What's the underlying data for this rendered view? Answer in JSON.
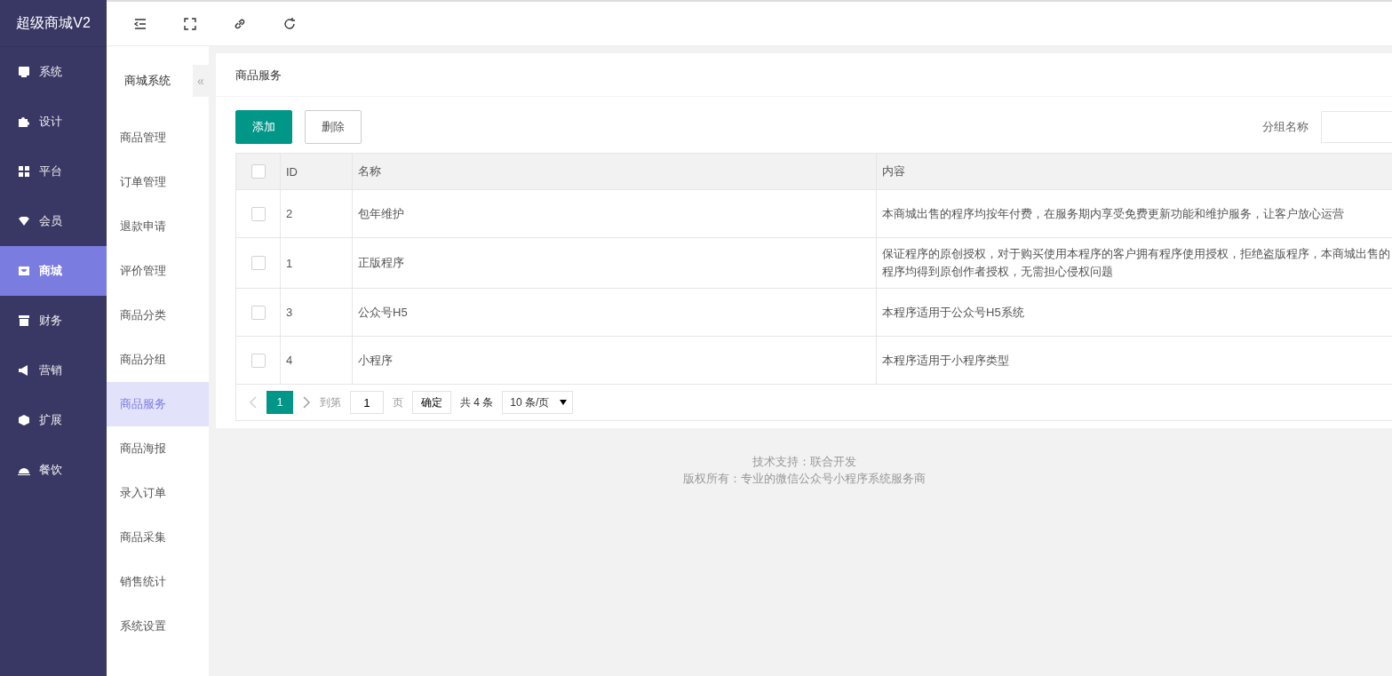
{
  "brand": "超级商城V2",
  "nav": [
    {
      "label": "系统",
      "selected": false
    },
    {
      "label": "设计",
      "selected": false
    },
    {
      "label": "平台",
      "selected": false
    },
    {
      "label": "会员",
      "selected": false
    },
    {
      "label": "商城",
      "selected": true
    },
    {
      "label": "财务",
      "selected": false
    },
    {
      "label": "营销",
      "selected": false
    },
    {
      "label": "扩展",
      "selected": false
    },
    {
      "label": "餐饮",
      "selected": false
    }
  ],
  "subnav": {
    "title": "商城系统",
    "collapse": "«",
    "items": [
      {
        "label": "商品管理",
        "selected": false
      },
      {
        "label": "订单管理",
        "selected": false
      },
      {
        "label": "退款申请",
        "selected": false
      },
      {
        "label": "评价管理",
        "selected": false
      },
      {
        "label": "商品分类",
        "selected": false
      },
      {
        "label": "商品分组",
        "selected": false
      },
      {
        "label": "商品服务",
        "selected": true
      },
      {
        "label": "商品海报",
        "selected": false
      },
      {
        "label": "录入订单",
        "selected": false
      },
      {
        "label": "商品采集",
        "selected": false
      },
      {
        "label": "销售统计",
        "selected": false
      },
      {
        "label": "系统设置",
        "selected": false
      }
    ]
  },
  "page_title": "商品服务",
  "buttons": [
    {
      "label": "添加",
      "kind": "primary"
    },
    {
      "label": "删除",
      "kind": "plain"
    }
  ],
  "filter": {
    "label": "分组名称"
  },
  "table": {
    "header_checked": false,
    "columns": [
      "ID",
      "名称",
      "内容"
    ],
    "rows": [
      {
        "checked": false,
        "id": "2",
        "name": "包年维护",
        "content": "本商城出售的程序均按年付费，在服务期内享受免费更新功能和维护服务，让客户放心运营"
      },
      {
        "checked": false,
        "id": "1",
        "name": "正版程序",
        "content": "保证程序的原创授权，对于购买使用本程序的客户拥有程序使用授权，拒绝盗版程序，本商城出售的程序均得到原创作者授权，无需担心侵权问题"
      },
      {
        "checked": false,
        "id": "3",
        "name": "公众号H5",
        "content": "本程序适用于公众号H5系统"
      },
      {
        "checked": false,
        "id": "4",
        "name": "小程序",
        "content": "本程序适用于小程序类型"
      }
    ]
  },
  "pagination": {
    "pages": [
      {
        "label": "1",
        "selected": true
      }
    ],
    "goto_label": "到第",
    "goto_value": "1",
    "page_label": "页",
    "confirm": "确定",
    "total": "共 4 条",
    "page_size": "10 条/页"
  },
  "footer": [
    "技术支持：联合开发",
    "版权所有：专业的微信公众号小程序系统服务商"
  ]
}
